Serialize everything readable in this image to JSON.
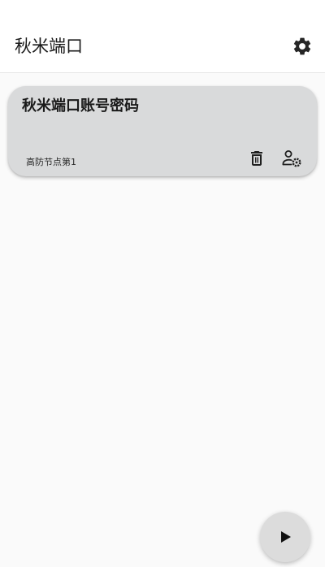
{
  "appbar": {
    "title": "秋米端口",
    "settings_icon": "gear-icon"
  },
  "card": {
    "title": "秋米端口账号密码",
    "subtitle": "高防节点第1",
    "delete_icon": "trash-icon",
    "manage_icon": "user-settings-icon"
  },
  "fab": {
    "icon": "play-icon"
  },
  "colors": {
    "appbar_bg": "#ffffff",
    "page_bg": "#fafafa",
    "card_bg": "#d9dadb",
    "fab_bg": "#dcdcdc",
    "text": "#1a1a1a"
  }
}
